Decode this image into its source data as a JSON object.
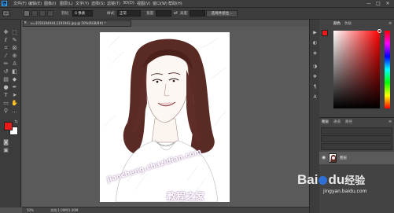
{
  "menubar": {
    "logo": "Ps",
    "items": [
      "文件(F)",
      "编辑(E)",
      "图像(I)",
      "图层(L)",
      "文字(Y)",
      "选择(S)",
      "滤镜(T)",
      "3D(D)",
      "视图(V)",
      "窗口(W)",
      "帮助(H)"
    ],
    "window_buttons": [
      "—",
      "□",
      "✕"
    ]
  },
  "options": {
    "feather_label": "羽化:",
    "feather_value": "0 像素",
    "style_label": "样式:",
    "style_value": "正常",
    "width_label": "宽度:",
    "height_label": "高度:",
    "refine_button": "选择并遮住..."
  },
  "document": {
    "tab_title": "u=3556194944,1191981.jpg @ 50%(RGB/8#) *",
    "close_glyph": "×",
    "zoom": "50%",
    "status": "文档:1.00M/1.00M"
  },
  "colors": {
    "foreground": "#e81a1a",
    "background": "#ffffff",
    "accent": "#31a8ff"
  },
  "color_panel": {
    "tabs": [
      "颜色",
      "色板"
    ]
  },
  "layers_panel": {
    "tabs": [
      "图层",
      "通道",
      "路径"
    ],
    "layer_name": "图层"
  },
  "watermarks": {
    "url1": "jiaocheng.chazidian.com",
    "site_cn": "教程之家",
    "baidu_brand": "Bai",
    "baidu_du": "du",
    "baidu_jy": "经验",
    "baidu_url": "jingyan.baidu.com"
  }
}
